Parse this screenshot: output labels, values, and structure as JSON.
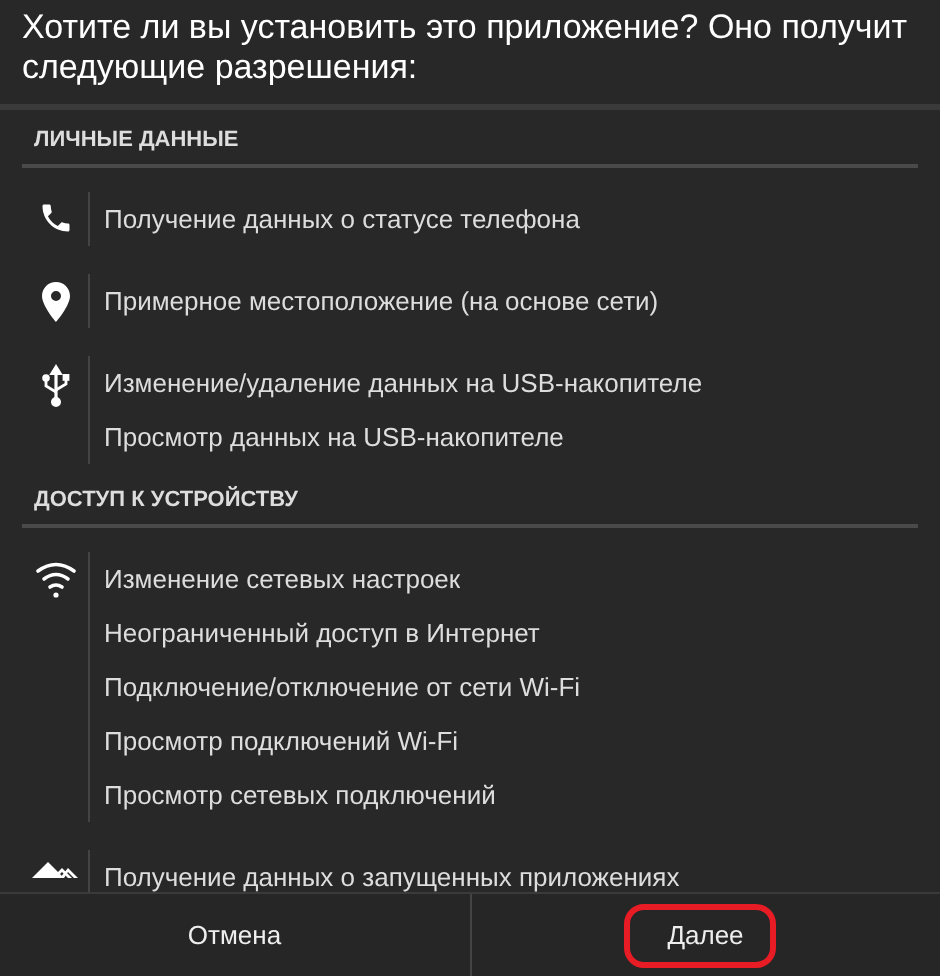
{
  "title": "Хотите ли вы установить это приложение? Оно получит следующие разрешения:",
  "sections": [
    {
      "title": "ЛИЧНЫЕ ДАННЫЕ",
      "groups": [
        {
          "kind": "phone",
          "items": [
            "Получение данных о статусе телефона"
          ]
        },
        {
          "kind": "location",
          "items": [
            "Примерное местоположение (на основе сети)"
          ]
        },
        {
          "kind": "usb",
          "items": [
            "Изменение/удаление данных на USB-накопителе",
            "Просмотр данных на USB-накопителе"
          ]
        }
      ]
    },
    {
      "title": "ДОСТУП К УСТРОЙСТВУ",
      "groups": [
        {
          "kind": "wifi",
          "items": [
            "Изменение сетевых настроек",
            "Неограниченный доступ в Интернет",
            "Подключение/отключение от сети Wi-Fi",
            "Просмотр подключений Wi-Fi",
            "Просмотр сетевых подключений"
          ]
        },
        {
          "kind": "apps",
          "items": [
            "Получение данных о запущенных приложениях"
          ]
        }
      ]
    }
  ],
  "buttons": [
    {
      "label": "Отмена",
      "highlighted": false
    },
    {
      "label": "Далее",
      "highlighted": true
    }
  ]
}
